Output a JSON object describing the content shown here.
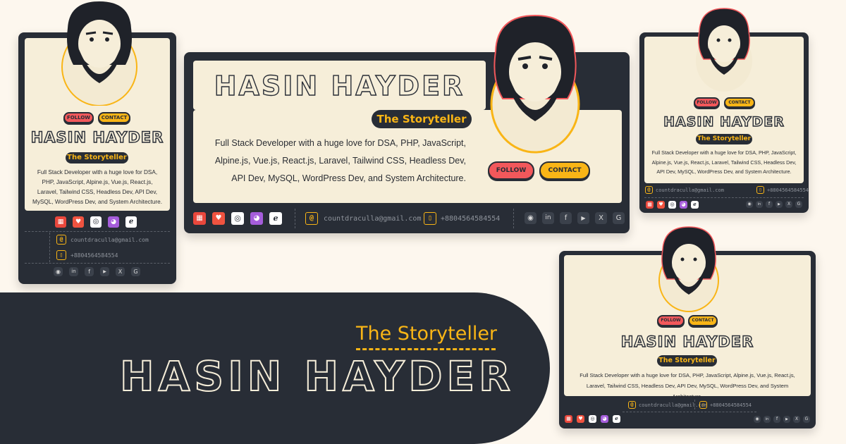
{
  "profile": {
    "name": "HASIN HAYDER",
    "tagline": "The Storyteller",
    "bio": "Full Stack Developer with a huge love for DSA, PHP, JavaScript, Alpine.js, Vue.js, React.js, Laravel, Tailwind CSS, Headless Dev, API Dev, MySQL, WordPress Dev, and System Architecture.",
    "email": "countdraculla@gmail.com",
    "phone": "+8804564584554"
  },
  "buttons": {
    "follow": "FOLLOW",
    "contact": "CONTACT"
  },
  "tech_icons": [
    "codeforces-icon",
    "laravel-icon",
    "hackerrank-icon",
    "php-icon",
    "wordpress-icon"
  ],
  "social_icons": [
    "github-icon",
    "linkedin-icon",
    "facebook-icon",
    "youtube-icon",
    "x-icon",
    "google-icon"
  ],
  "glyphs": {
    "email": "@",
    "phone": "▯",
    "github": "◉",
    "linkedin": "in",
    "facebook": "f",
    "youtube": "▶",
    "x": "X",
    "google": "G"
  },
  "colors": {
    "dark": "#282d36",
    "cream": "#f6eed9",
    "accent_yellow": "#f9b516",
    "accent_red": "#f2585b",
    "page_bg": "#fdf7ee"
  }
}
